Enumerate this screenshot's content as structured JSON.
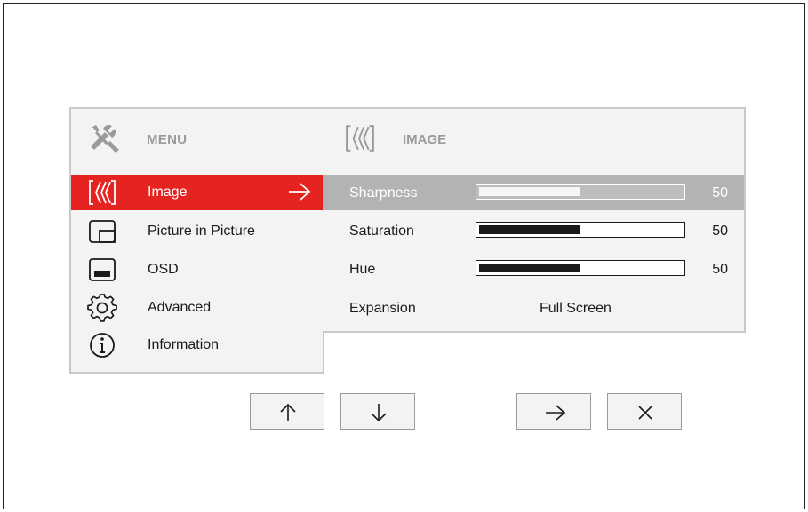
{
  "menu": {
    "header_title": "MENU",
    "header_icon": "wrench-screwdriver-icon",
    "items": [
      {
        "label": "Image",
        "icon": "image-icon",
        "selected": true
      },
      {
        "label": "Picture in Picture",
        "icon": "pip-icon",
        "selected": false
      },
      {
        "label": "OSD",
        "icon": "osd-icon",
        "selected": false
      },
      {
        "label": "Advanced",
        "icon": "gear-icon",
        "selected": false
      },
      {
        "label": "Information",
        "icon": "info-icon",
        "selected": false
      }
    ]
  },
  "image_panel": {
    "header_title": "IMAGE",
    "header_icon": "image-icon",
    "rows": [
      {
        "label": "Sharpness",
        "value": "50",
        "level": 0.5,
        "selected": true
      },
      {
        "label": "Saturation",
        "value": "50",
        "level": 0.5,
        "selected": false
      },
      {
        "label": "Hue",
        "value": "50",
        "level": 0.5,
        "selected": false
      }
    ],
    "expansion": {
      "label": "Expansion",
      "value": "Full Screen"
    }
  },
  "nav": {
    "buttons": [
      "up-arrow-icon",
      "down-arrow-icon",
      "right-arrow-icon",
      "close-icon"
    ]
  },
  "colors": {
    "accent": "#e52421",
    "selected_row": "#b3b3b3",
    "panel_bg": "#f3f3f3",
    "header_text": "#9a9a9a"
  }
}
